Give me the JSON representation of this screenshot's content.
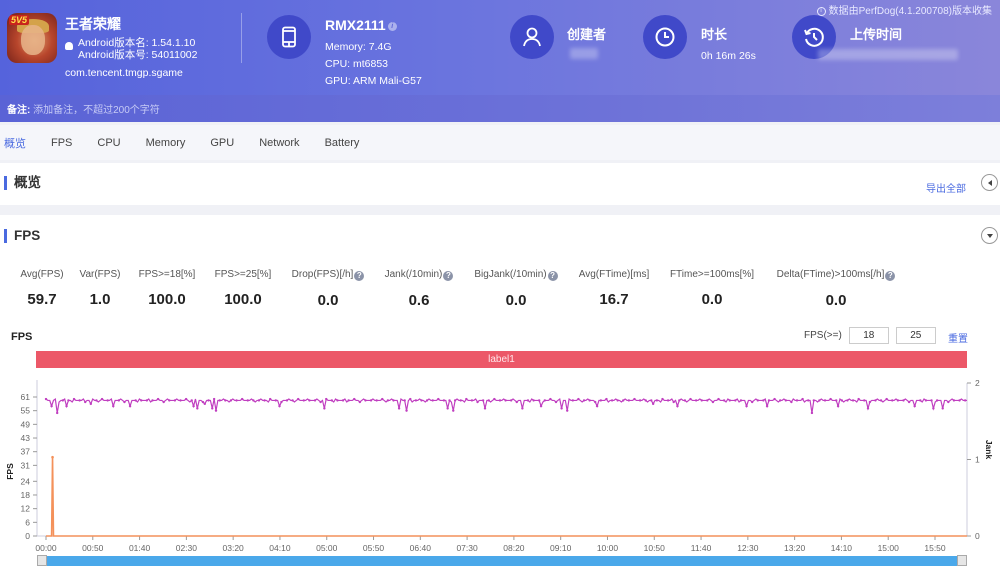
{
  "header": {
    "app": {
      "name": "王者荣耀",
      "icon_badge": "5V5",
      "version_name": "Android版本名: 1.54.1.10",
      "version_code": "Android版本号: 54011002",
      "package": "com.tencent.tmgp.sgame"
    },
    "device": {
      "model": "RMX2111",
      "memory": "Memory: 7.4G",
      "cpu": "CPU: mt6853",
      "gpu": "GPU: ARM Mali-G57"
    },
    "creator": {
      "title": "创建者"
    },
    "duration": {
      "title": "时长",
      "value": "0h 16m 26s"
    },
    "upload": {
      "title": "上传时间"
    },
    "source_note": "数据由PerfDog(4.1.200708)版本收集"
  },
  "note": {
    "label": "备注:",
    "placeholder": "添加备注，不超过200个字符"
  },
  "tabs": [
    {
      "label": "概览",
      "active": true
    },
    {
      "label": "FPS"
    },
    {
      "label": "CPU"
    },
    {
      "label": "Memory"
    },
    {
      "label": "GPU"
    },
    {
      "label": "Network"
    },
    {
      "label": "Battery"
    }
  ],
  "overview": {
    "title": "概览",
    "export_label": "导出全部"
  },
  "fps_section": {
    "title": "FPS",
    "metrics": [
      {
        "label": "Avg(FPS)",
        "value": "59.7",
        "help": false
      },
      {
        "label": "Var(FPS)",
        "value": "1.0",
        "help": false
      },
      {
        "label": "FPS>=18[%]",
        "value": "100.0",
        "help": false
      },
      {
        "label": "FPS>=25[%]",
        "value": "100.0",
        "help": false
      },
      {
        "label": "Drop(FPS)[/h]",
        "value": "0.0",
        "help": true
      },
      {
        "label": "Jank(/10min)",
        "value": "0.6",
        "help": true
      },
      {
        "label": "BigJank(/10min)",
        "value": "0.0",
        "help": true
      },
      {
        "label": "Avg(FTime)[ms]",
        "value": "16.7",
        "help": false
      },
      {
        "label": "FTime>=100ms[%]",
        "value": "0.0",
        "help": false
      },
      {
        "label": "Delta(FTime)>100ms[/h]",
        "value": "0.0",
        "help": true
      }
    ],
    "chart_title": "FPS",
    "filter": {
      "label": "FPS(>=)",
      "value1": "18",
      "value2": "25",
      "reset_label": "重置"
    },
    "band_label": "label1"
  },
  "colors": {
    "accent": "#4a6ae0",
    "fps_series": "#c03fc0",
    "jank_series": "#f4915a",
    "label_band": "#ec5868",
    "scrollbar": "#4aa8ea"
  },
  "chart_data": {
    "type": "line",
    "title": "FPS",
    "xlabel": "",
    "ylabel": "FPS",
    "y2label": "Jank",
    "x_tick_labels": [
      "00:00",
      "00:50",
      "01:40",
      "02:30",
      "03:20",
      "04:10",
      "05:00",
      "05:50",
      "06:40",
      "07:30",
      "08:20",
      "09:10",
      "10:00",
      "10:50",
      "11:40",
      "12:30",
      "13:20",
      "14:10",
      "15:00",
      "15:50"
    ],
    "y_ticks": [
      0,
      6,
      12,
      18,
      24,
      31,
      37,
      43,
      49,
      55,
      61
    ],
    "y2_ticks": [
      0,
      1,
      2
    ],
    "ylim": [
      0,
      61
    ],
    "y2lim": [
      0,
      2
    ],
    "x_range_seconds": [
      0,
      986
    ],
    "grid": false,
    "series": [
      {
        "name": "FPS",
        "axis": "left",
        "baseline": 59.5,
        "dips": [
          {
            "t": 6,
            "v": 57
          },
          {
            "t": 12,
            "v": 54
          },
          {
            "t": 22,
            "v": 57
          },
          {
            "t": 25,
            "v": 53
          },
          {
            "t": 48,
            "v": 58
          },
          {
            "t": 72,
            "v": 57
          },
          {
            "t": 90,
            "v": 57
          },
          {
            "t": 105,
            "v": 58
          },
          {
            "t": 125,
            "v": 57
          },
          {
            "t": 158,
            "v": 57
          },
          {
            "t": 162,
            "v": 56
          },
          {
            "t": 170,
            "v": 58
          },
          {
            "t": 178,
            "v": 56
          },
          {
            "t": 182,
            "v": 55
          },
          {
            "t": 187,
            "v": 57
          },
          {
            "t": 250,
            "v": 57
          },
          {
            "t": 255,
            "v": 56
          },
          {
            "t": 265,
            "v": 57
          },
          {
            "t": 298,
            "v": 56
          },
          {
            "t": 378,
            "v": 56
          },
          {
            "t": 386,
            "v": 55
          },
          {
            "t": 430,
            "v": 56
          },
          {
            "t": 436,
            "v": 55
          },
          {
            "t": 470,
            "v": 56
          },
          {
            "t": 510,
            "v": 56
          },
          {
            "t": 530,
            "v": 57
          },
          {
            "t": 552,
            "v": 56
          },
          {
            "t": 558,
            "v": 55
          },
          {
            "t": 590,
            "v": 57
          },
          {
            "t": 623,
            "v": 56
          },
          {
            "t": 650,
            "v": 58
          },
          {
            "t": 667,
            "v": 57
          },
          {
            "t": 676,
            "v": 57
          },
          {
            "t": 750,
            "v": 57
          },
          {
            "t": 772,
            "v": 57
          },
          {
            "t": 820,
            "v": 54
          },
          {
            "t": 823,
            "v": 52
          },
          {
            "t": 848,
            "v": 57
          },
          {
            "t": 880,
            "v": 56
          },
          {
            "t": 915,
            "v": 56
          },
          {
            "t": 930,
            "v": 57
          },
          {
            "t": 950,
            "v": 56
          },
          {
            "t": 960,
            "v": 56
          },
          {
            "t": 975,
            "v": 55
          }
        ]
      },
      {
        "name": "Jank",
        "axis": "right",
        "points": [
          {
            "t": 0,
            "v": 0
          },
          {
            "t": 6,
            "v": 0
          },
          {
            "t": 7,
            "v": 1.03
          },
          {
            "t": 8,
            "v": 0
          },
          {
            "t": 986,
            "v": 0
          }
        ]
      }
    ]
  }
}
